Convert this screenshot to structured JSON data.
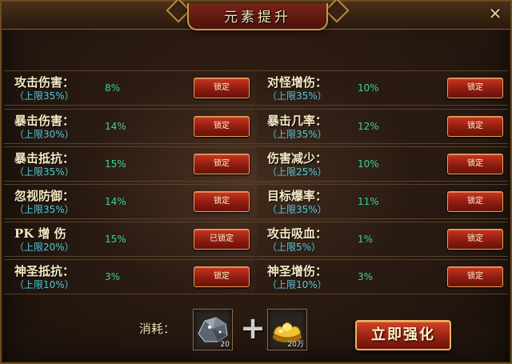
{
  "window": {
    "title": "元素提升",
    "close_glyph": "✕"
  },
  "left_rows": [
    {
      "name": "攻击伤害：",
      "limit": "（上限35%）",
      "value": "8%",
      "button": "锁定"
    },
    {
      "name": "暴击伤害：",
      "limit": "（上限30%）",
      "value": "14%",
      "button": "锁定"
    },
    {
      "name": "暴击抵抗：",
      "limit": "（上限35%）",
      "value": "15%",
      "button": "锁定"
    },
    {
      "name": "忽视防御：",
      "limit": "（上限35%）",
      "value": "14%",
      "button": "锁定"
    },
    {
      "name": "PK 增 伤",
      "limit": "（上限20%）",
      "value": "15%",
      "button": "已锁定"
    },
    {
      "name": "神圣抵抗：",
      "limit": "（上限10%）",
      "value": "3%",
      "button": "锁定"
    }
  ],
  "right_rows": [
    {
      "name": "对怪增伤：",
      "limit": "（上限35%）",
      "value": "10%",
      "button": "锁定"
    },
    {
      "name": "暴击几率：",
      "limit": "（上限35%）",
      "value": "12%",
      "button": "锁定"
    },
    {
      "name": "伤害减少：",
      "limit": "（上限25%）",
      "value": "10%",
      "button": "锁定"
    },
    {
      "name": "目标爆率：",
      "limit": "（上限35%）",
      "value": "11%",
      "button": "锁定"
    },
    {
      "name": "攻击吸血：",
      "limit": "（上限5%）",
      "value": "1%",
      "button": "锁定"
    },
    {
      "name": "神圣增伤：",
      "limit": "（上限10%）",
      "value": "3%",
      "button": "锁定"
    }
  ],
  "cost": {
    "label": "消耗：",
    "plus": "+",
    "items": [
      {
        "icon": "ore-stone-icon",
        "qty": "20"
      },
      {
        "icon": "gold-ingot-icon",
        "qty": "20万"
      }
    ]
  },
  "actions": {
    "enhance_label": "立即强化"
  },
  "colors": {
    "name_text": "#f6e9c4",
    "limit_text": "#4ec9dc",
    "value_text": "#38d39a",
    "button_red": "#9f2414",
    "gold_border": "#c9974a"
  }
}
